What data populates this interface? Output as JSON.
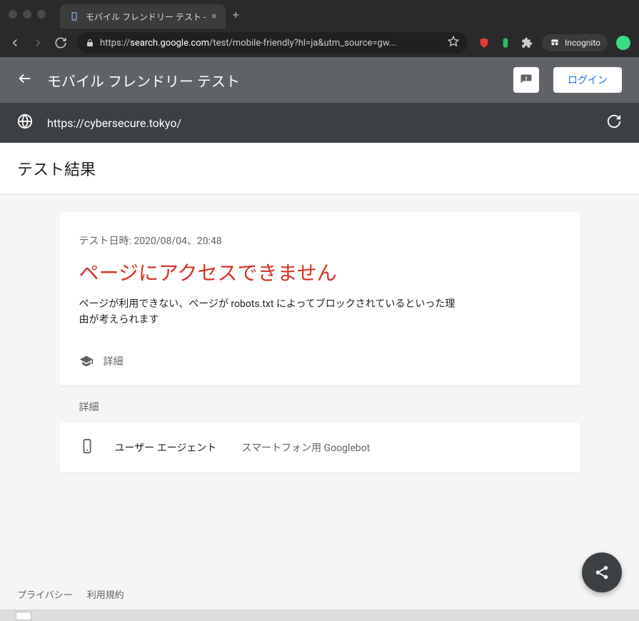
{
  "browser": {
    "tab_title": "モバイル フレンドリー テスト - ",
    "url_host": "search.google.com",
    "url_prefix": "https://",
    "url_path": "/test/mobile-friendly?hl=ja&utm_source=gw...",
    "incognito_label": "Incognito"
  },
  "header": {
    "title": "モバイル フレンドリー テスト",
    "login_label": "ログイン"
  },
  "input": {
    "url": "https://cybersecure.tokyo/"
  },
  "results": {
    "heading": "テスト結果",
    "timestamp": "テスト日時: 2020/08/04、20:48",
    "error_title": "ページにアクセスできません",
    "error_desc": "ページが利用できない、ページが robots.txt によってブロックされているといった理由が考えられます",
    "details_link": "詳細"
  },
  "details": {
    "section_label": "詳細",
    "rows": [
      {
        "key": "ユーザー エージェント",
        "value": "スマートフォン用 Googlebot"
      }
    ]
  },
  "footer": {
    "privacy": "プライバシー",
    "terms": "利用規約"
  }
}
